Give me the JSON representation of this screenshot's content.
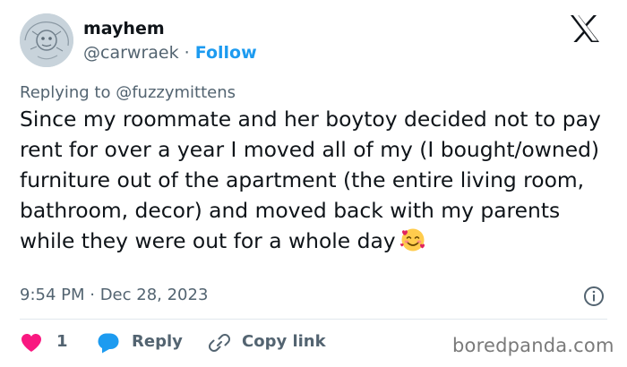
{
  "user": {
    "display_name": "mayhem",
    "handle": "@carwraek",
    "separator": "·",
    "follow_label": "Follow"
  },
  "header": {
    "logo_icon": "x-logo-icon"
  },
  "reply_context": {
    "prefix": "Replying to",
    "mention": "@fuzzymittens"
  },
  "tweet": {
    "text": "Since my roommate and her boytoy decided not to pay rent for over a year I moved all of my (I bought/owned) furniture out of the apartment (the entire living room, bathroom, decor) and moved back with my parents while they were out for a whole day",
    "emoji_icon": "smiling-face-with-hearts-icon",
    "timestamp": "9:54 PM · Dec 28, 2023"
  },
  "actions": {
    "like_count": "1",
    "reply_label": "Reply",
    "copy_link_label": "Copy link"
  },
  "watermark": "boredpanda.com",
  "colors": {
    "accent": "#1d9bf0",
    "like": "#f91880",
    "text": "#0f1419",
    "secondary": "#536471"
  }
}
